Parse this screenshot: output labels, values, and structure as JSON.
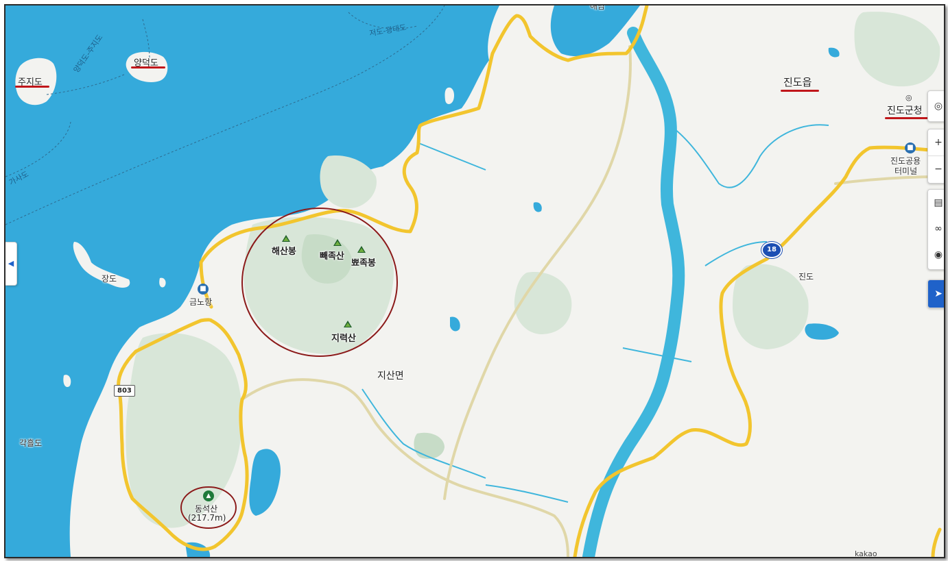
{
  "map": {
    "colors": {
      "sea": "#35aadb",
      "land": "#f3f3f0",
      "forest": "#d8e6d8",
      "forest_dark": "#c7dcc7",
      "road_major": "#f2c52e",
      "road_minor": "#e0d7a8",
      "water_channel": "#3fb6dc",
      "highlight_circle": "#8b1a1a",
      "underline": "#c0161a"
    },
    "labels": {
      "jujido": "주지도",
      "yangdeokdo": "양덕도",
      "route_yangdeok_juji": "양덕도-주지도",
      "route_jeodo_gwangdae": "저도-광대도",
      "route_gasado": "가사도",
      "jindo_eup": "진도읍",
      "jindo_gun_office": "진도군청",
      "bus_terminal_line1": "진도공용",
      "bus_terminal_line2": "터미널",
      "jangdo": "장도",
      "geumno_port": "금노항",
      "haesanbong": "해산봉",
      "ppaejoksan": "빼족산",
      "ppyeojokbong": "뾰족봉",
      "jiryeoksan": "지력산",
      "jisan_myeon": "지산면",
      "gakheuldo": "각흘도",
      "jindo": "진도",
      "dongseoksan": "동석산",
      "dongseoksan_height": "(217.7m)",
      "route_18": "18",
      "route_803": "803",
      "attribution": "kakao",
      "top_cut_label": "해남"
    },
    "icons": [
      "mountain-peak-icon",
      "bus-terminal-icon",
      "government-office-icon",
      "route-shield-icon",
      "collapse-arrow-icon",
      "gps-icon",
      "zoom-in-icon",
      "zoom-out-icon",
      "map-type-icon",
      "distance-icon",
      "place-pin-icon"
    ],
    "controls": {
      "zoom_in": "+",
      "zoom_out": "−",
      "side_toggle": "◀"
    }
  }
}
